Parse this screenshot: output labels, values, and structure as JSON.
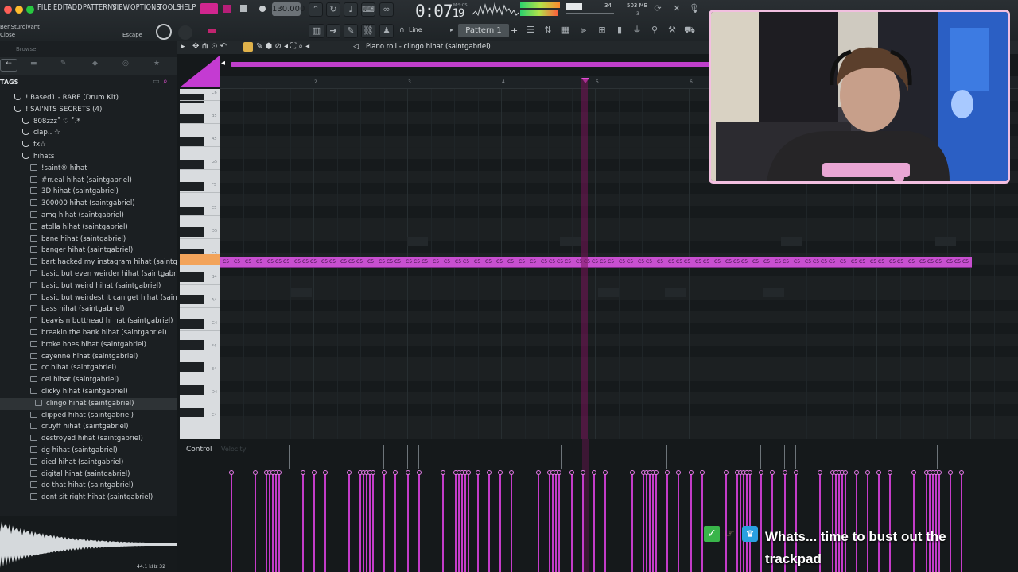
{
  "menu": [
    "FILE",
    "EDIT",
    "ADD",
    "PATTERNS",
    "VIEW",
    "OPTIONS",
    "TOOLS",
    "HELP"
  ],
  "transport": {
    "tempo": "130.000",
    "time": "0:07",
    "time_sub": "19",
    "time_label": "M:S:CS",
    "cpu": "34",
    "mem": "503 MB",
    "mem_sub": "3"
  },
  "user": {
    "name": "BenSturdivant",
    "action": "Close",
    "escape": "Escape"
  },
  "toolbar": {
    "snap": "Line",
    "pattern": "Pattern 1"
  },
  "browser": {
    "title": "Browser",
    "tags_label": "TAGS",
    "items": [
      {
        "label": "! Based1 - RARE (Drum Kit)",
        "indent": 1,
        "kind": "folder"
      },
      {
        "label": "! SAI'NTS SECRETS (4)",
        "indent": 1,
        "kind": "folder"
      },
      {
        "label": "808zzz˚ ♡ ˚.*",
        "indent": 2,
        "kind": "folder"
      },
      {
        "label": "clap.. ☆",
        "indent": 2,
        "kind": "folder"
      },
      {
        "label": "fx☆",
        "indent": 2,
        "kind": "folder"
      },
      {
        "label": "hihats",
        "indent": 2,
        "kind": "folder"
      },
      {
        "label": "!saint® hihat",
        "indent": 3,
        "kind": "file"
      },
      {
        "label": "#rr.eal hihat (saintgabriel)",
        "indent": 3,
        "kind": "file"
      },
      {
        "label": "3D hihat (saintgabriel)",
        "indent": 3,
        "kind": "file"
      },
      {
        "label": "300000 hihat (saintgabriel)",
        "indent": 3,
        "kind": "file"
      },
      {
        "label": "amg hihat (saintgabriel)",
        "indent": 3,
        "kind": "file"
      },
      {
        "label": "atolla hihat (saintgabriel)",
        "indent": 3,
        "kind": "file"
      },
      {
        "label": "bane hihat (saintgabriel)",
        "indent": 3,
        "kind": "file"
      },
      {
        "label": "banger hihat (saintgabriel)",
        "indent": 3,
        "kind": "file"
      },
      {
        "label": "bart hacked my instagram hihat (saintgabriel)",
        "indent": 3,
        "kind": "file"
      },
      {
        "label": "basic but even weirder hihat (saintgabriel)",
        "indent": 3,
        "kind": "file"
      },
      {
        "label": "basic but weird hihat (saintgabriel)",
        "indent": 3,
        "kind": "file"
      },
      {
        "label": "basic but weirdest it can get hihat (saintgabriel)",
        "indent": 3,
        "kind": "file"
      },
      {
        "label": "bass hihat (saintgabriel)",
        "indent": 3,
        "kind": "file"
      },
      {
        "label": "beavis n butthead hi hat (saintgabriel)",
        "indent": 3,
        "kind": "file"
      },
      {
        "label": "breakin the bank hihat (saintgabriel)",
        "indent": 3,
        "kind": "file"
      },
      {
        "label": "broke hoes hihat (saintgabriel)",
        "indent": 3,
        "kind": "file"
      },
      {
        "label": "cayenne hihat (saintgabriel)",
        "indent": 3,
        "kind": "file"
      },
      {
        "label": "cc hihat (saintgabriel)",
        "indent": 3,
        "kind": "file"
      },
      {
        "label": "cel hihat (saintgabriel)",
        "indent": 3,
        "kind": "file"
      },
      {
        "label": "clicky hihat (saintgabriel)",
        "indent": 3,
        "kind": "file"
      },
      {
        "label": "clingo hihat (saintgabriel)",
        "indent": 3,
        "kind": "file",
        "selected": true
      },
      {
        "label": "clipped hihat (saintgabriel)",
        "indent": 3,
        "kind": "file"
      },
      {
        "label": "cruyff hihat (saintgabriel)",
        "indent": 3,
        "kind": "file"
      },
      {
        "label": "destroyed hihat (saintgabriel)",
        "indent": 3,
        "kind": "file"
      },
      {
        "label": "dg hihat (saintgabriel)",
        "indent": 3,
        "kind": "file"
      },
      {
        "label": "died hihat (saintgabriel)",
        "indent": 3,
        "kind": "file"
      },
      {
        "label": "digital hihat (saintgabriel)",
        "indent": 3,
        "kind": "file"
      },
      {
        "label": "do that hihat (saintgabriel)",
        "indent": 3,
        "kind": "file"
      },
      {
        "label": "dont sit right hihat (saintgabriel)",
        "indent": 3,
        "kind": "file"
      }
    ],
    "wave_info": "44.1 kHz 32"
  },
  "pianoroll": {
    "title": "Piano roll - clingo hihat (saintgabriel)",
    "bar_numbers": [
      "2",
      "3",
      "4",
      "5",
      "6"
    ],
    "note_name": "C5",
    "key_labels": [
      "C6",
      "B5",
      "A5",
      "G5",
      "F5",
      "E5",
      "D5",
      "C5",
      "B4",
      "A4",
      "G4",
      "F4",
      "E4",
      "D4",
      "C4"
    ],
    "control_label": "Control",
    "control_param": "Velocity"
  },
  "chat": {
    "text": "Whats... time to bust out the trackpad"
  },
  "colors": {
    "accent": "#c84fd0",
    "accent_light": "#f19bf6",
    "webcam_border": "#f2bfe0"
  }
}
